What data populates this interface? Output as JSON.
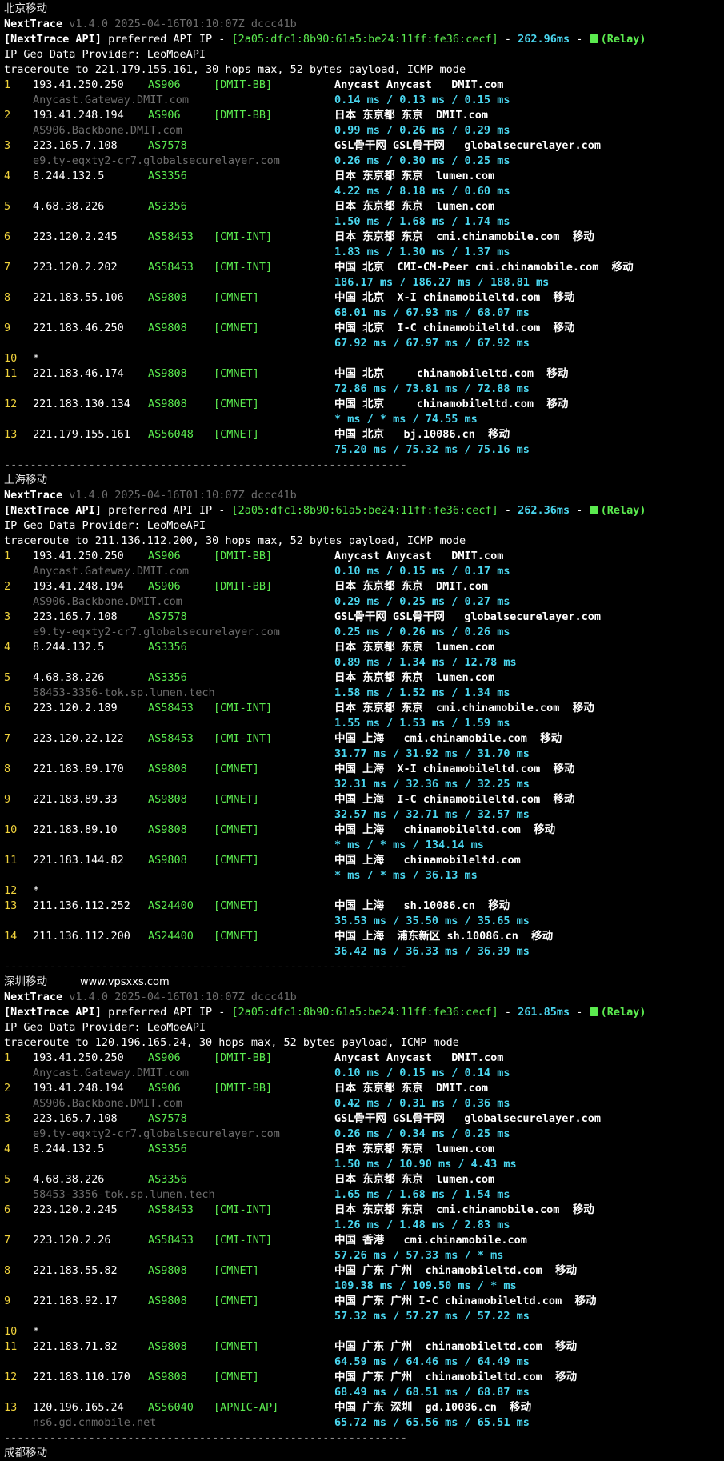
{
  "watermark": "www.vpsxxs.com",
  "separator": "--------------------------------------------------------------",
  "trailing_title": "成都移动",
  "sections": [
    {
      "title": "北京移动",
      "app": "NextTrace",
      "version": "v1.4.0 2025-04-16T01:10:07Z dccc41b",
      "api_prefix": "[NextTrace API]",
      "api_text": "preferred API IP - ",
      "api_ip": "[2a05:dfc1:8b90:61a5:be24:11ff:fe36:cecf]",
      "api_dash": " - ",
      "api_ms": "262.96ms",
      "api_relay": " - ",
      "relay_label": "(Relay)",
      "provider": "IP Geo Data Provider: LeoMoeAPI",
      "traceroute": "traceroute to 221.179.155.161, 30 hops max, 52 bytes payload, ICMP mode",
      "hops": [
        {
          "n": "1",
          "ip": "193.41.250.250",
          "asn": "AS906",
          "tag": "[DMIT-BB]",
          "geo": "Anycast Anycast   DMIT.com",
          "rdns": "Anycast.Gateway.DMIT.com",
          "lat": "0.14 ms / 0.13 ms / 0.15 ms"
        },
        {
          "n": "2",
          "ip": "193.41.248.194",
          "asn": "AS906",
          "tag": "[DMIT-BB]",
          "geo": "日本 东京都 东京  DMIT.com",
          "rdns": "AS906.Backbone.DMIT.com",
          "lat": "0.99 ms / 0.26 ms / 0.29 ms"
        },
        {
          "n": "3",
          "ip": "223.165.7.108",
          "asn": "AS7578",
          "tag": "",
          "geo": "GSL骨干网 GSL骨干网   globalsecurelayer.com",
          "rdns": "e9.ty-eqxty2-cr7.globalsecurelayer.com",
          "lat": "0.26 ms / 0.30 ms / 0.25 ms"
        },
        {
          "n": "4",
          "ip": "8.244.132.5",
          "asn": "AS3356",
          "tag": "",
          "geo": "日本 东京都 东京  lumen.com",
          "rdns": "",
          "lat": "4.22 ms / 8.18 ms / 0.60 ms"
        },
        {
          "n": "5",
          "ip": "4.68.38.226",
          "asn": "AS3356",
          "tag": "",
          "geo": "日本 东京都 东京  lumen.com",
          "rdns": "",
          "lat": "1.50 ms / 1.68 ms / 1.74 ms"
        },
        {
          "n": "6",
          "ip": "223.120.2.245",
          "asn": "AS58453",
          "tag": "[CMI-INT]",
          "geo": "日本 东京都 东京  cmi.chinamobile.com  移动",
          "rdns": "",
          "lat": "1.83 ms / 1.30 ms / 1.37 ms"
        },
        {
          "n": "7",
          "ip": "223.120.2.202",
          "asn": "AS58453",
          "tag": "[CMI-INT]",
          "geo": "中国 北京  CMI-CM-Peer cmi.chinamobile.com  移动",
          "rdns": "",
          "lat": "186.17 ms / 186.27 ms / 188.81 ms"
        },
        {
          "n": "8",
          "ip": "221.183.55.106",
          "asn": "AS9808",
          "tag": "[CMNET]",
          "geo": "中国 北京  X-I chinamobileltd.com  移动",
          "rdns": "",
          "lat": "68.01 ms / 67.93 ms / 68.07 ms"
        },
        {
          "n": "9",
          "ip": "221.183.46.250",
          "asn": "AS9808",
          "tag": "[CMNET]",
          "geo": "中国 北京  I-C chinamobileltd.com  移动",
          "rdns": "",
          "lat": "67.92 ms / 67.97 ms / 67.92 ms"
        },
        {
          "n": "10",
          "ip": "*",
          "asn": "",
          "tag": "",
          "geo": "",
          "rdns": "",
          "lat": ""
        },
        {
          "n": "11",
          "ip": "221.183.46.174",
          "asn": "AS9808",
          "tag": "[CMNET]",
          "geo": "中国 北京     chinamobileltd.com  移动",
          "rdns": "",
          "lat": "72.86 ms / 73.81 ms / 72.88 ms"
        },
        {
          "n": "12",
          "ip": "221.183.130.134",
          "asn": "AS9808",
          "tag": "[CMNET]",
          "geo": "中国 北京     chinamobileltd.com  移动",
          "rdns": "",
          "lat": "* ms / * ms / 74.55 ms"
        },
        {
          "n": "13",
          "ip": "221.179.155.161",
          "asn": "AS56048",
          "tag": "[CMNET]",
          "geo": "中国 北京   bj.10086.cn  移动",
          "rdns": "",
          "lat": "75.20 ms / 75.32 ms / 75.16 ms"
        }
      ]
    },
    {
      "title": "上海移动",
      "app": "NextTrace",
      "version": "v1.4.0 2025-04-16T01:10:07Z dccc41b",
      "api_prefix": "[NextTrace API]",
      "api_text": "preferred API IP - ",
      "api_ip": "[2a05:dfc1:8b90:61a5:be24:11ff:fe36:cecf]",
      "api_dash": " - ",
      "api_ms": "262.36ms",
      "api_relay": " - ",
      "relay_label": "(Relay)",
      "provider": "IP Geo Data Provider: LeoMoeAPI",
      "traceroute": "traceroute to 211.136.112.200, 30 hops max, 52 bytes payload, ICMP mode",
      "hops": [
        {
          "n": "1",
          "ip": "193.41.250.250",
          "asn": "AS906",
          "tag": "[DMIT-BB]",
          "geo": "Anycast Anycast   DMIT.com",
          "rdns": "Anycast.Gateway.DMIT.com",
          "lat": "0.10 ms / 0.15 ms / 0.17 ms"
        },
        {
          "n": "2",
          "ip": "193.41.248.194",
          "asn": "AS906",
          "tag": "[DMIT-BB]",
          "geo": "日本 东京都 东京  DMIT.com",
          "rdns": "AS906.Backbone.DMIT.com",
          "lat": "0.29 ms / 0.25 ms / 0.27 ms"
        },
        {
          "n": "3",
          "ip": "223.165.7.108",
          "asn": "AS7578",
          "tag": "",
          "geo": "GSL骨干网 GSL骨干网   globalsecurelayer.com",
          "rdns": "e9.ty-eqxty2-cr7.globalsecurelayer.com",
          "lat": "0.25 ms / 0.26 ms / 0.26 ms"
        },
        {
          "n": "4",
          "ip": "8.244.132.5",
          "asn": "AS3356",
          "tag": "",
          "geo": "日本 东京都 东京  lumen.com",
          "rdns": "",
          "lat": "0.89 ms / 1.34 ms / 12.78 ms"
        },
        {
          "n": "5",
          "ip": "4.68.38.226",
          "asn": "AS3356",
          "tag": "",
          "geo": "日本 东京都 东京  lumen.com",
          "rdns": "58453-3356-tok.sp.lumen.tech",
          "lat": "1.58 ms / 1.52 ms / 1.34 ms"
        },
        {
          "n": "6",
          "ip": "223.120.2.189",
          "asn": "AS58453",
          "tag": "[CMI-INT]",
          "geo": "日本 东京都 东京  cmi.chinamobile.com  移动",
          "rdns": "",
          "lat": "1.55 ms / 1.53 ms / 1.59 ms"
        },
        {
          "n": "7",
          "ip": "223.120.22.122",
          "asn": "AS58453",
          "tag": "[CMI-INT]",
          "geo": "中国 上海   cmi.chinamobile.com  移动",
          "rdns": "",
          "lat": "31.77 ms / 31.92 ms / 31.70 ms"
        },
        {
          "n": "8",
          "ip": "221.183.89.170",
          "asn": "AS9808",
          "tag": "[CMNET]",
          "geo": "中国 上海  X-I chinamobileltd.com  移动",
          "rdns": "",
          "lat": "32.31 ms / 32.36 ms / 32.25 ms"
        },
        {
          "n": "9",
          "ip": "221.183.89.33",
          "asn": "AS9808",
          "tag": "[CMNET]",
          "geo": "中国 上海  I-C chinamobileltd.com  移动",
          "rdns": "",
          "lat": "32.57 ms / 32.71 ms / 32.57 ms"
        },
        {
          "n": "10",
          "ip": "221.183.89.10",
          "asn": "AS9808",
          "tag": "[CMNET]",
          "geo": "中国 上海   chinamobileltd.com  移动",
          "rdns": "",
          "lat": "* ms / * ms / 134.14 ms"
        },
        {
          "n": "11",
          "ip": "221.183.144.82",
          "asn": "AS9808",
          "tag": "[CMNET]",
          "geo": "中国 上海   chinamobileltd.com",
          "rdns": "",
          "lat": "* ms / * ms / 36.13 ms"
        },
        {
          "n": "12",
          "ip": "*",
          "asn": "",
          "tag": "",
          "geo": "",
          "rdns": "",
          "lat": ""
        },
        {
          "n": "13",
          "ip": "211.136.112.252",
          "asn": "AS24400",
          "tag": "[CMNET]",
          "geo": "中国 上海   sh.10086.cn  移动",
          "rdns": "",
          "lat": "35.53 ms / 35.50 ms / 35.65 ms"
        },
        {
          "n": "14",
          "ip": "211.136.112.200",
          "asn": "AS24400",
          "tag": "[CMNET]",
          "geo": "中国 上海  浦东新区 sh.10086.cn  移动",
          "rdns": "",
          "lat": "36.42 ms / 36.33 ms / 36.39 ms"
        }
      ]
    },
    {
      "title": "深圳移动",
      "app": "NextTrace",
      "version": "v1.4.0 2025-04-16T01:10:07Z dccc41b",
      "api_prefix": "[NextTrace API]",
      "api_text": "preferred API IP - ",
      "api_ip": "[2a05:dfc1:8b90:61a5:be24:11ff:fe36:cecf]",
      "api_dash": " - ",
      "api_ms": "261.85ms",
      "api_relay": " - ",
      "relay_label": "(Relay)",
      "provider": "IP Geo Data Provider: LeoMoeAPI",
      "traceroute": "traceroute to 120.196.165.24, 30 hops max, 52 bytes payload, ICMP mode",
      "hops": [
        {
          "n": "1",
          "ip": "193.41.250.250",
          "asn": "AS906",
          "tag": "[DMIT-BB]",
          "geo": "Anycast Anycast   DMIT.com",
          "rdns": "Anycast.Gateway.DMIT.com",
          "lat": "0.10 ms / 0.15 ms / 0.14 ms"
        },
        {
          "n": "2",
          "ip": "193.41.248.194",
          "asn": "AS906",
          "tag": "[DMIT-BB]",
          "geo": "日本 东京都 东京  DMIT.com",
          "rdns": "AS906.Backbone.DMIT.com",
          "lat": "0.42 ms / 0.31 ms / 0.36 ms"
        },
        {
          "n": "3",
          "ip": "223.165.7.108",
          "asn": "AS7578",
          "tag": "",
          "geo": "GSL骨干网 GSL骨干网   globalsecurelayer.com",
          "rdns": "e9.ty-eqxty2-cr7.globalsecurelayer.com",
          "lat": "0.26 ms / 0.34 ms / 0.25 ms"
        },
        {
          "n": "4",
          "ip": "8.244.132.5",
          "asn": "AS3356",
          "tag": "",
          "geo": "日本 东京都 东京  lumen.com",
          "rdns": "",
          "lat": "1.50 ms / 10.90 ms / 4.43 ms"
        },
        {
          "n": "5",
          "ip": "4.68.38.226",
          "asn": "AS3356",
          "tag": "",
          "geo": "日本 东京都 东京  lumen.com",
          "rdns": "58453-3356-tok.sp.lumen.tech",
          "lat": "1.65 ms / 1.68 ms / 1.54 ms"
        },
        {
          "n": "6",
          "ip": "223.120.2.245",
          "asn": "AS58453",
          "tag": "[CMI-INT]",
          "geo": "日本 东京都 东京  cmi.chinamobile.com  移动",
          "rdns": "",
          "lat": "1.26 ms / 1.48 ms / 2.83 ms"
        },
        {
          "n": "7",
          "ip": "223.120.2.26",
          "asn": "AS58453",
          "tag": "[CMI-INT]",
          "geo": "中国 香港   cmi.chinamobile.com",
          "rdns": "",
          "lat": "57.26 ms / 57.33 ms / * ms"
        },
        {
          "n": "8",
          "ip": "221.183.55.82",
          "asn": "AS9808",
          "tag": "[CMNET]",
          "geo": "中国 广东 广州  chinamobileltd.com  移动",
          "rdns": "",
          "lat": "109.38 ms / 109.50 ms / * ms"
        },
        {
          "n": "9",
          "ip": "221.183.92.17",
          "asn": "AS9808",
          "tag": "[CMNET]",
          "geo": "中国 广东 广州 I-C chinamobileltd.com  移动",
          "rdns": "",
          "lat": "57.32 ms / 57.27 ms / 57.22 ms"
        },
        {
          "n": "10",
          "ip": "*",
          "asn": "",
          "tag": "",
          "geo": "",
          "rdns": "",
          "lat": ""
        },
        {
          "n": "11",
          "ip": "221.183.71.82",
          "asn": "AS9808",
          "tag": "[CMNET]",
          "geo": "中国 广东 广州  chinamobileltd.com  移动",
          "rdns": "",
          "lat": "64.59 ms / 64.46 ms / 64.49 ms"
        },
        {
          "n": "12",
          "ip": "221.183.110.170",
          "asn": "AS9808",
          "tag": "[CMNET]",
          "geo": "中国 广东 广州  chinamobileltd.com  移动",
          "rdns": "",
          "lat": "68.49 ms / 68.51 ms / 68.87 ms"
        },
        {
          "n": "13",
          "ip": "120.196.165.24",
          "asn": "AS56040",
          "tag": "[APNIC-AP]",
          "geo": "中国 广东 深圳  gd.10086.cn  移动",
          "rdns": "ns6.gd.cnmobile.net",
          "lat": "65.72 ms / 65.56 ms / 65.51 ms"
        }
      ]
    }
  ]
}
